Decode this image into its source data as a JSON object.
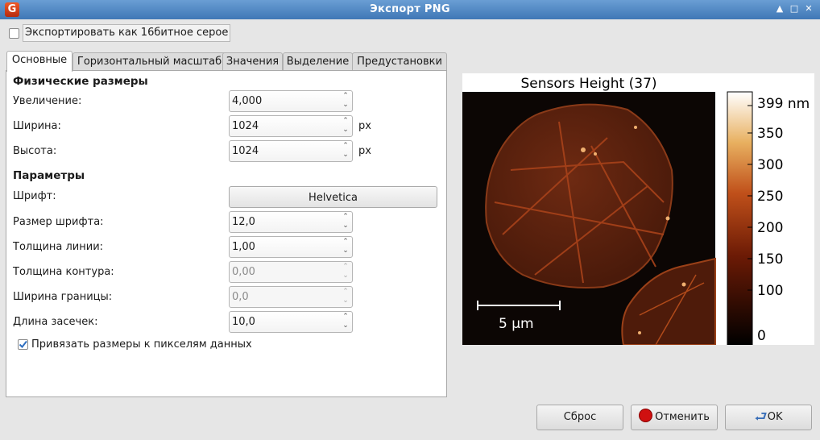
{
  "window": {
    "title": "Экспорт PNG",
    "icon": "gwyddion-app-icon"
  },
  "export_16bit": {
    "label": "Экспортировать как 16битное серое",
    "checked": false
  },
  "tabs": [
    "Основные",
    "Горизонтальный масштаб",
    "Значения",
    "Выделение",
    "Предустановки"
  ],
  "active_tab": 0,
  "physical": {
    "heading": "Физические размеры",
    "zoom": {
      "label": "Увеличение:",
      "value": "4,000"
    },
    "width": {
      "label": "Ширина:",
      "value": "1024",
      "unit": "px"
    },
    "height": {
      "label": "Высота:",
      "value": "1024",
      "unit": "px"
    }
  },
  "params": {
    "heading": "Параметры",
    "font": {
      "label": "Шрифт:",
      "value": "Helvetica"
    },
    "font_size": {
      "label": "Размер шрифта:",
      "value": "12,0"
    },
    "line_width": {
      "label": "Толщина линии:",
      "value": "1,00"
    },
    "outline_width": {
      "label": "Толщина контура:",
      "value": "0,00"
    },
    "border_width": {
      "label": "Ширина границы:",
      "value": "0,0"
    },
    "tick_length": {
      "label": "Длина засечек:",
      "value": "10,0"
    }
  },
  "snap": {
    "label": "Привязать размеры к пикселям данных",
    "checked": true
  },
  "preview": {
    "title": "Sensors Height (37)",
    "scalebar_label": "5 µm",
    "colorbar_ticks": [
      "399 nm",
      "350",
      "300",
      "250",
      "200",
      "150",
      "100",
      "0"
    ]
  },
  "buttons": {
    "reset": "Сброс",
    "cancel": "Отменить",
    "ok": "OK"
  },
  "colors": {
    "titlebar": "#4f86c6",
    "colormap_low": "#000000",
    "colormap_mid": "#b5421a",
    "colormap_high": "#ffffff"
  }
}
